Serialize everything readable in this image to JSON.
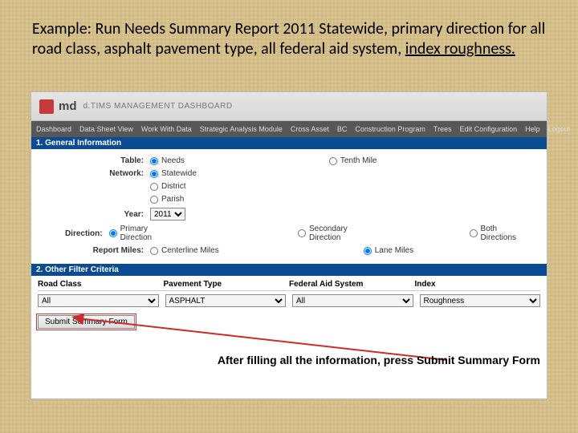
{
  "slide": {
    "title_prefix": "Example: Run Needs Summary Report 2011 Statewide, primary direction for all road class, asphalt pavement type, all federal aid system, ",
    "title_underlined": "index roughness."
  },
  "header": {
    "logo_text": "md",
    "logo_sub": "d.TIMS   MANAGEMENT DASHBOARD"
  },
  "nav": {
    "items": [
      "Dashboard",
      "Data Sheet View",
      "Work With Data",
      "Strategic Analysis Module",
      "Cross Asset",
      "BC",
      "Construction Program",
      "Trees",
      "Edit Configuration",
      "Help",
      "Logout"
    ]
  },
  "sections": {
    "general": "1. General Information",
    "other": "2. Other Filter Criteria"
  },
  "form": {
    "table_label": "Table:",
    "table_opts": {
      "needs": "Needs",
      "tenth_mile": "Tenth Mile"
    },
    "network_label": "Network:",
    "network_opts": {
      "statewide": "Statewide",
      "district": "District",
      "parish": "Parish"
    },
    "year_label": "Year:",
    "year_value": "2011",
    "direction_label": "Direction:",
    "direction_opts": {
      "primary": "Primary Direction",
      "secondary": "Secondary Direction",
      "both": "Both Directions"
    },
    "miles_label": "Report Miles:",
    "miles_opts": {
      "centerline": "Centerline Miles",
      "lane": "Lane Miles"
    }
  },
  "filters": {
    "headers": {
      "road": "Road Class",
      "pave": "Pavement Type",
      "fed": "Federal Aid System",
      "index": "Index"
    },
    "values": {
      "road": "All",
      "pave": "ASPHALT",
      "fed": "All",
      "index": "Roughness"
    }
  },
  "buttons": {
    "submit": "Submit Summary Form"
  },
  "caption": "After filling all the information, press Submit Summary Form"
}
